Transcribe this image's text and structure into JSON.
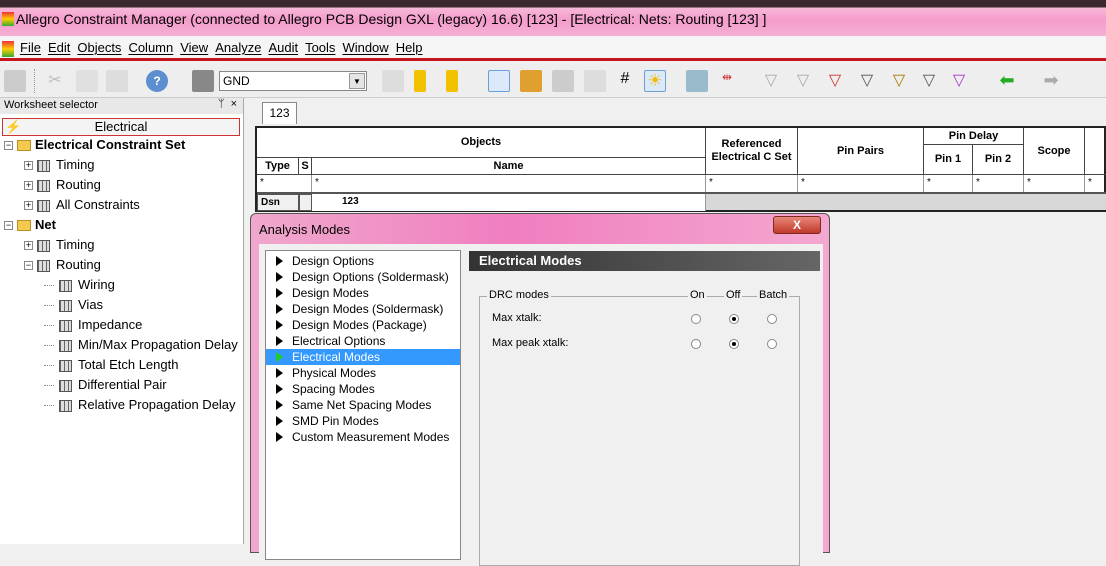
{
  "window": {
    "title": "Allegro Constraint Manager (connected to Allegro PCB Design GXL (legacy) 16.6) [123] - [Electrical:  Nets:  Routing [123] ]"
  },
  "menu": [
    "File",
    "Edit",
    "Objects",
    "Column",
    "View",
    "Analyze",
    "Audit",
    "Tools",
    "Window",
    "Help"
  ],
  "toolbar": {
    "net_combo_value": "GND"
  },
  "worksheet_selector": {
    "title": "Worksheet selector",
    "pin": "ᛘ",
    "close": "×",
    "active_button": "Electrical",
    "tree": [
      {
        "label": "Electrical Constraint Set",
        "level": 0,
        "bold": true,
        "expander": "−"
      },
      {
        "label": "Timing",
        "level": 1,
        "expander": "+"
      },
      {
        "label": "Routing",
        "level": 1,
        "expander": "+"
      },
      {
        "label": "All Constraints",
        "level": 1,
        "expander": "+"
      },
      {
        "label": "Net",
        "level": 0,
        "bold": true,
        "expander": "−"
      },
      {
        "label": "Timing",
        "level": 1,
        "expander": "+"
      },
      {
        "label": "Routing",
        "level": 1,
        "expander": "−"
      },
      {
        "label": "Wiring",
        "level": 2
      },
      {
        "label": "Vias",
        "level": 2
      },
      {
        "label": "Impedance",
        "level": 2
      },
      {
        "label": "Min/Max Propagation Delay",
        "level": 2
      },
      {
        "label": "Total Etch Length",
        "level": 2
      },
      {
        "label": "Differential Pair",
        "level": 2
      },
      {
        "label": "Relative Propagation Delay",
        "level": 2
      }
    ]
  },
  "worksheet": {
    "tab": "123",
    "headers": {
      "objects": "Objects",
      "type": "Type",
      "s": "S",
      "name": "Name",
      "ref_cset": "Referenced Electrical C Set",
      "pin_pairs": "Pin Pairs",
      "pin_delay": "Pin Delay",
      "pin1": "Pin 1",
      "pin2": "Pin 2",
      "scope": "Scope"
    },
    "filter": "*",
    "row": {
      "type": "Dsn",
      "name": "123"
    }
  },
  "dialog": {
    "title": "Analysis Modes",
    "close": "X",
    "modes": [
      "Design Options",
      "Design Options (Soldermask)",
      "Design Modes",
      "Design Modes (Soldermask)",
      "Design Modes (Package)",
      "Electrical Options",
      "Electrical Modes",
      "Physical Modes",
      "Spacing Modes",
      "Same Net Spacing Modes",
      "SMD Pin Modes",
      "Custom Measurement Modes"
    ],
    "selected_mode": "Electrical Modes",
    "panel_title": "Electrical Modes",
    "group": "DRC modes",
    "columns": [
      "On",
      "Off",
      "Batch"
    ],
    "rows": [
      {
        "label": "Max xtalk:",
        "value": "Off"
      },
      {
        "label": "Max peak xtalk:",
        "value": "Off"
      }
    ]
  }
}
